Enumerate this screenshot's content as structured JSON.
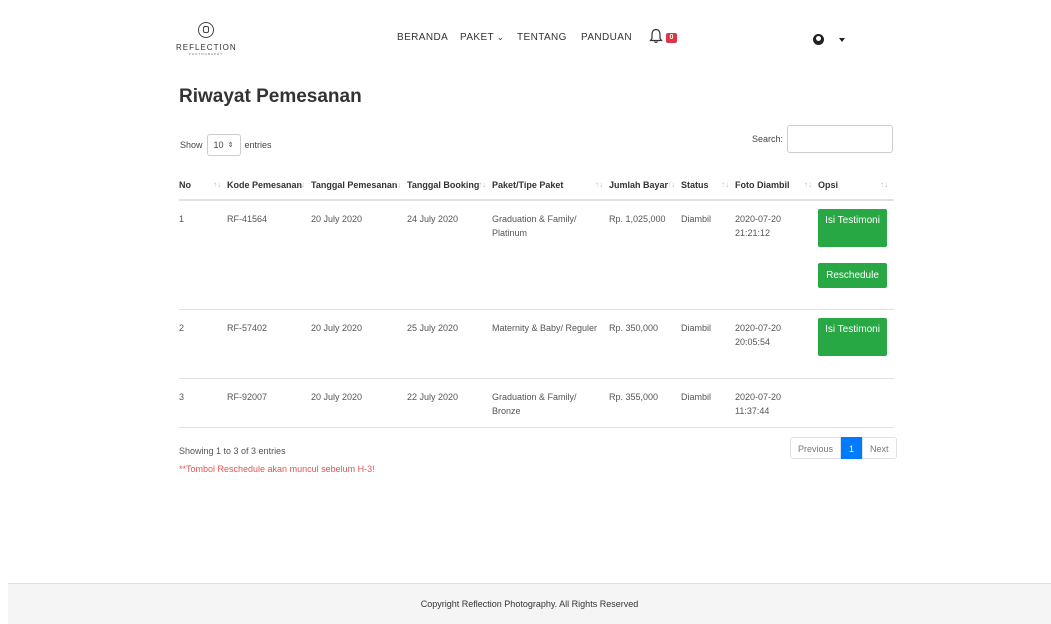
{
  "brand": {
    "name": "REFLECTION",
    "sub": "PHOTOGRAPHY"
  },
  "nav": {
    "items": [
      "BERANDA",
      "PAKET",
      "TENTANG",
      "PANDUAN"
    ],
    "notif_count": "0"
  },
  "page": {
    "title": "Riwayat Pemesanan"
  },
  "controls": {
    "show_label": "Show",
    "entries_value": "10",
    "entries_label": "entries",
    "search_label": "Search:"
  },
  "table": {
    "headers": [
      "No",
      "Kode Pemesanan",
      "Tanggal Pemesanan",
      "Tanggal Booking",
      "Paket/Tipe Paket",
      "Jumlah Bayar",
      "Status",
      "Foto Diambil",
      "Opsi"
    ],
    "rows": [
      {
        "no": "1",
        "kode": "RF-41564",
        "tgl_pesan": "20 July 2020",
        "tgl_booking": "24 July 2020",
        "paket": "Graduation & Family/ Platinum",
        "bayar": "Rp. 1,025,000",
        "status": "Diambil",
        "foto": "2020-07-20 21:21:12",
        "btn_testi": "Isi Testimoni",
        "btn_resch": "Reschedule"
      },
      {
        "no": "2",
        "kode": "RF-57402",
        "tgl_pesan": "20 July 2020",
        "tgl_booking": "25 July 2020",
        "paket": "Maternity & Baby/ Reguler",
        "bayar": "Rp. 350,000",
        "status": "Diambil",
        "foto": "2020-07-20 20:05:54",
        "btn_testi": "Isi Testimoni"
      },
      {
        "no": "3",
        "kode": "RF-92007",
        "tgl_pesan": "20 July 2020",
        "tgl_booking": "22 July 2020",
        "paket": "Graduation & Family/ Bronze",
        "bayar": "Rp. 355,000",
        "status": "Diambil",
        "foto": "2020-07-20 11:37:44"
      }
    ]
  },
  "info": "Showing 1 to 3 of 3 entries",
  "note": "**Tombol Reschedule akan muncul sebelum H-3!",
  "pagination": {
    "previous": "Previous",
    "current": "1",
    "next": "Next"
  },
  "footer": "Copyright Reflection Photography. All Rights Reserved",
  "colors": {
    "primary": "#007bff",
    "success": "#28a745",
    "danger": "#dc3545",
    "note": "#e05555"
  },
  "icons": [
    "logo-icon",
    "bell-icon",
    "user-circle-icon",
    "caret-down-icon",
    "chevron-down-icon",
    "sort-icon"
  ]
}
